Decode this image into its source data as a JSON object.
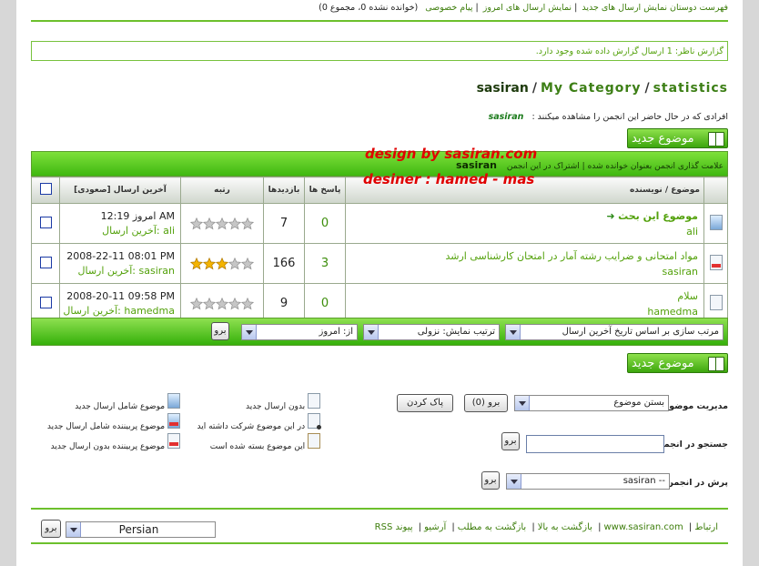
{
  "top_nav": {
    "items": [
      "فهرست دوستان نمایش ارسال های جدید",
      "نمایش ارسال های امروز",
      "پیام خصوصی"
    ],
    "pm_status": "(خوانده نشده 0، مجموع 0)"
  },
  "report": {
    "label": "گزارش ناظر:",
    "text": "1 ارسال گزارش داده شده وجود دارد."
  },
  "breadcrumb": {
    "root": "statistics",
    "category": "My Category",
    "current": "sasiran"
  },
  "viewers": {
    "label": "افرادی که در حال حاضر این انجمن را مشاهده میکنند :",
    "user": "sasiran"
  },
  "new_topic_label": "موضوع جدید",
  "forum_header": {
    "mark_read": "علامت گذاری انجمن بعنوان خوانده شده",
    "subscribe": "اشتراک در این انجمن",
    "forum_name": "sasiran"
  },
  "watermark": {
    "line1": "design by sasiran.com",
    "line2": "desiner :  hamed - mas"
  },
  "table": {
    "headers": {
      "topic": "موضوع / نویسنده",
      "replies": "پاسخ ها",
      "views": "بازدیدها",
      "rating": "رتبه",
      "last_post": "آخرین ارسال [صعودی]"
    },
    "rows": [
      {
        "title": "موضوع این بحث",
        "author": "ali",
        "replies": "0",
        "views": "7",
        "rating": 0,
        "last_date": "امروز 12:19 AM",
        "last_label": "آخرین ارسال:",
        "last_user": "ali",
        "icon": "topic-new-icon"
      },
      {
        "title": "مواد امتحانی و ضرایب رشته آمار در امتحان کارشناسی ارشد",
        "author": "sasiran",
        "replies": "3",
        "views": "166",
        "rating": 3,
        "last_date": "2008-22-11 08:01 PM",
        "last_label": "آخرین ارسال:",
        "last_user": "sasiran",
        "icon": "topic-hot-icon"
      },
      {
        "title": "سلام",
        "author": "hamedma",
        "replies": "0",
        "views": "9",
        "rating": 0,
        "last_date": "2008-20-11 09:58 PM",
        "last_label": "آخرین ارسال:",
        "last_user": "hamedma",
        "icon": "topic-icon"
      }
    ]
  },
  "sort_bar": {
    "sort_by": "مرتب سازی بر اساس تاریخ آخرین ارسال",
    "order": "ترتیب نمایش: نزولی",
    "from": "از: امروز",
    "go": "برو"
  },
  "moderation": {
    "label": "مدیریت موضوع",
    "selected": "بستن موضوع",
    "go": "برو (0)",
    "clear": "پاک کردن"
  },
  "search": {
    "label": "جستجو در انجمن",
    "go": "برو"
  },
  "jump": {
    "label": "پرش در انجمن:",
    "selected": "-- sasiran",
    "go": "برو"
  },
  "legend": [
    {
      "text": "موضوع شامل ارسال جدید",
      "icon": "new-posts-topic-icon"
    },
    {
      "text": "موضوع پربیننده شامل ارسال جدید",
      "icon": "hot-new-posts-topic-icon"
    },
    {
      "text": "موضوع پربیننده بدون ارسال جدید",
      "icon": "hot-topic-icon"
    },
    {
      "text": "بدون ارسال جدید",
      "icon": "no-new-posts-icon"
    },
    {
      "text": "در این موضوع شرکت داشته اید",
      "icon": "participated-topic-icon"
    },
    {
      "text": "این موضوع بسته شده است",
      "icon": "locked-topic-icon"
    }
  ],
  "footer": {
    "language": "Persian",
    "go": "برو",
    "links": [
      "ارتباط",
      "www.sasiran.com",
      "بازگشت به بالا",
      "بازگشت به مطلب",
      "آرشیو",
      "پیوند RSS"
    ]
  },
  "colors": {
    "accent_green": "#3fb811",
    "link_green": "#3c7d0a",
    "watermark_red": "#e00000"
  }
}
